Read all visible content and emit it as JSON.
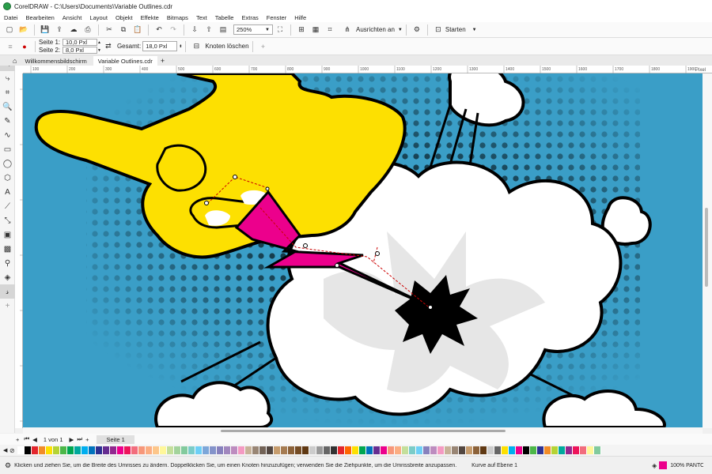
{
  "window": {
    "title": "CorelDRAW - C:\\Users\\Documents\\Variable Outlines.cdr"
  },
  "menu": [
    "Datei",
    "Bearbeiten",
    "Ansicht",
    "Layout",
    "Objekt",
    "Effekte",
    "Bitmaps",
    "Text",
    "Tabelle",
    "Extras",
    "Fenster",
    "Hilfe"
  ],
  "toolbar": {
    "zoom": "250%",
    "snap_label": "Ausrichten an",
    "launch_label": "Starten"
  },
  "property_bar": {
    "side1_label": "Seite 1:",
    "side1_value": "10,0 Pxl",
    "side2_label": "Seite 2:",
    "side2_value": "8,0 Pxl",
    "total_label": "Gesamt:",
    "total_value": "18,0 Pxl",
    "delete_node_label": "Knoten löschen"
  },
  "tabs": [
    {
      "label": "Willkommensbildschirm",
      "active": false
    },
    {
      "label": "Variable Outlines.cdr",
      "active": true
    }
  ],
  "rulers": {
    "h_ticks": [
      "100",
      "200",
      "300",
      "400",
      "500",
      "600",
      "700",
      "800",
      "900",
      "1000",
      "1100",
      "1200",
      "1300",
      "1400",
      "1500",
      "1600",
      "1700",
      "1800",
      "1900"
    ],
    "h_unit": "Pixel",
    "v_unit": "Pixel"
  },
  "page_nav": {
    "page_count_text": "1 von 1",
    "page_tab": "Seite 1"
  },
  "palette": [
    "#ffffff",
    "#000000",
    "#e3262d",
    "#f28c28",
    "#fde001",
    "#b5d334",
    "#4cb748",
    "#00a651",
    "#00a99d",
    "#00aeef",
    "#0072bc",
    "#2e3192",
    "#662d91",
    "#92278f",
    "#ec008c",
    "#ed145b",
    "#f26d7d",
    "#f7977a",
    "#fbad82",
    "#fdc68a",
    "#fff79a",
    "#c4df9b",
    "#a3d39c",
    "#82ca9d",
    "#7accc8",
    "#6dcff6",
    "#7da7d9",
    "#8493ca",
    "#8781bd",
    "#a187be",
    "#bd8cbf",
    "#f49ac2",
    "#c7b299",
    "#998675",
    "#736357",
    "#534741",
    "#c69c6d",
    "#a67c52",
    "#8c6239",
    "#754c24",
    "#603913",
    "#cccccc",
    "#999999",
    "#666666",
    "#333333",
    "#e3262d",
    "#ff6600",
    "#fde001",
    "#00a651",
    "#0072bc",
    "#662d91",
    "#ec008c",
    "#f7977a",
    "#fbad82",
    "#c4df9b",
    "#7accc8",
    "#6dcff6",
    "#8781bd",
    "#bd8cbf",
    "#f49ac2",
    "#c7b299",
    "#998675",
    "#534741",
    "#c69c6d",
    "#8c6239",
    "#603913",
    "#cccccc",
    "#666666",
    "#fde001",
    "#00aeef",
    "#ec008c",
    "#000000",
    "#4cb748",
    "#2e3192",
    "#f28c28",
    "#b5d334",
    "#00a99d",
    "#92278f",
    "#ed145b",
    "#f26d7d",
    "#fff79a",
    "#82ca9d"
  ],
  "status": {
    "hint": "Klicken und ziehen Sie, um die Breite des Umrisses zu ändern. Doppelklicken Sie, um einen Knoten hinzuzufügen; verwenden Sie die Ziehpunkte, um die Umrissbreite anzupassen.",
    "layer": "Kurve auf Ebene 1",
    "fill_label": "100% PANTONE"
  },
  "colors": {
    "sky": "#3a9ec7",
    "hand": "#fde001",
    "bolt": "#ec008c",
    "cloud": "#ffffff",
    "shade": "#e6e6e6"
  }
}
